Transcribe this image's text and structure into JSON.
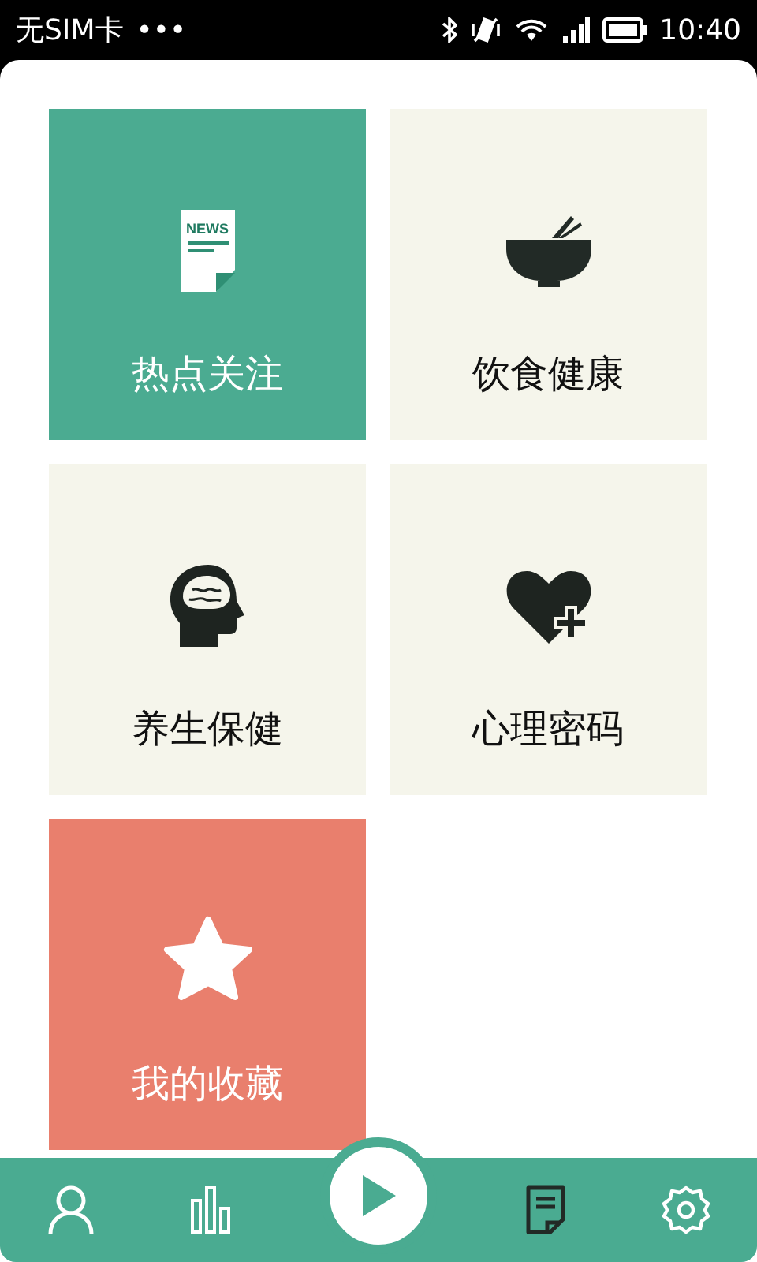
{
  "status_bar": {
    "carrier": "无SIM卡",
    "more": "•••",
    "time": "10:40"
  },
  "tiles": [
    {
      "label": "热点关注",
      "kind": "news",
      "color": "#4bab91",
      "icon_text": "NEWS"
    },
    {
      "label": "饮食健康",
      "kind": "bowl",
      "color": "#f5f5eb"
    },
    {
      "label": "养生保健",
      "kind": "brain",
      "color": "#f5f5eb"
    },
    {
      "label": "心理密码",
      "kind": "heart",
      "color": "#f5f5eb"
    },
    {
      "label": "我的收藏",
      "kind": "star",
      "color": "#e97f6d"
    }
  ],
  "nav": [
    {
      "kind": "user",
      "selected": false
    },
    {
      "kind": "chart",
      "selected": false
    },
    {
      "kind": "play",
      "selected": false
    },
    {
      "kind": "note",
      "selected": true
    },
    {
      "kind": "settings",
      "selected": false
    }
  ]
}
